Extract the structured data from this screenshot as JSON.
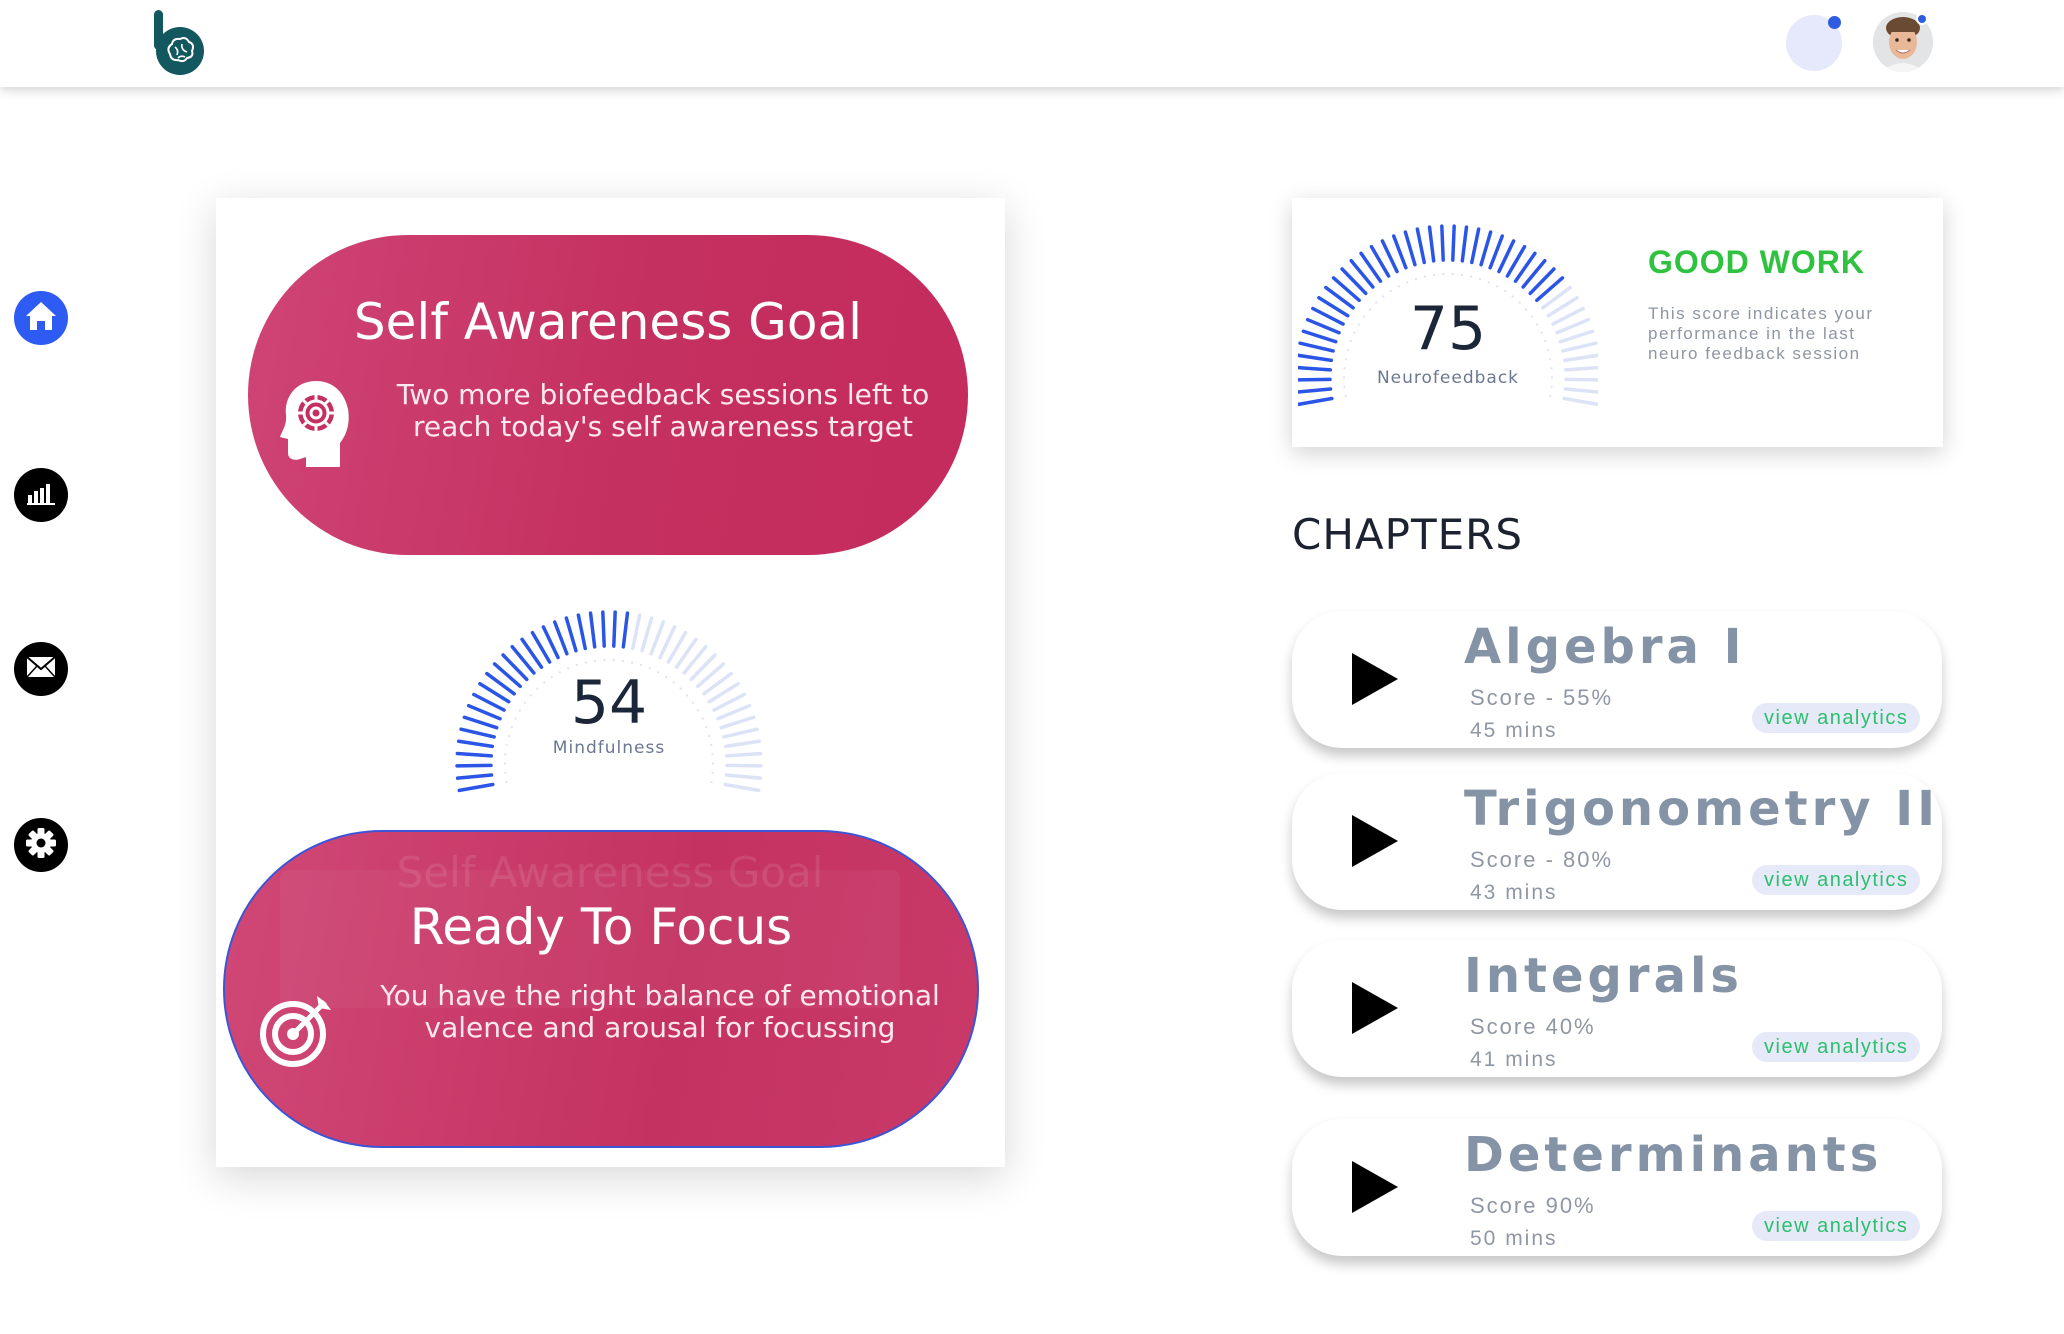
{
  "header": {
    "logo_icon": "brain-logo-icon",
    "notification_icon": "notification-icon",
    "avatar_icon": "user-avatar"
  },
  "sidebar": {
    "items": [
      {
        "icon": "home-icon",
        "active": true
      },
      {
        "icon": "analytics-icon",
        "active": false
      },
      {
        "icon": "mail-icon",
        "active": false
      },
      {
        "icon": "settings-icon",
        "active": false
      }
    ]
  },
  "left_card": {
    "goal": {
      "title": "Self Awareness Goal",
      "body": "Two more biofeedback sessions left to reach today's self awareness target",
      "icon": "head-gear-icon"
    },
    "mindfulness_gauge": {
      "value": "54",
      "label": "Mindfulness",
      "max": 100
    },
    "focus": {
      "ghost_title": "Self Awareness Goal",
      "title": "Ready To Focus",
      "body": "You have the right balance of emotional valence and arousal for focussing",
      "icon": "target-icon"
    }
  },
  "score_card": {
    "value": "75",
    "label": "Neurofeedback",
    "max": 100,
    "headline": "GOOD WORK",
    "description": "This score indicates your performance in the last neuro feedback session"
  },
  "chapters": {
    "heading": "CHAPTERS",
    "items": [
      {
        "name": "Algebra I",
        "score": "Score - 55%",
        "mins": "45 mins",
        "link": "view analytics"
      },
      {
        "name": "Trigonometry II",
        "score": "Score - 80%",
        "mins": "43 mins",
        "link": "view analytics"
      },
      {
        "name": "Integrals",
        "score": "Score 40%",
        "mins": "41 mins",
        "link": "view analytics"
      },
      {
        "name": "Determinants",
        "score": "Score 90%",
        "mins": "50 mins",
        "link": "view analytics"
      }
    ]
  },
  "colors": {
    "accent_blue": "#2f5bf5",
    "pill_pink": "#c4305f",
    "good_green": "#2ec23f",
    "link_green": "#2bbf6c"
  }
}
